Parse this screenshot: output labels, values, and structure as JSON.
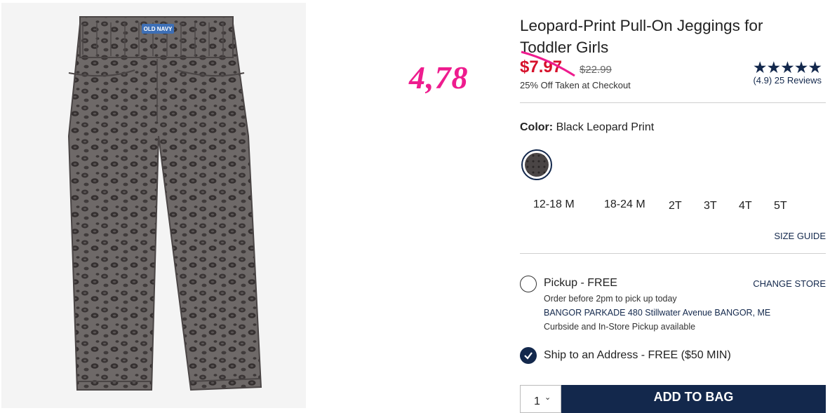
{
  "product": {
    "title": "Leopard-Print Pull-On Jeggings for Toddler Girls",
    "image_alt_icon": "jeggings-product-image",
    "waistband_logo": "OLD NAVY"
  },
  "annotation": {
    "handwritten_price": "4,78",
    "color": "#ee1c8e"
  },
  "pricing": {
    "sale_price": "$7.97",
    "original_price": "$22.99",
    "discount_note": "25% Off Taken at Checkout",
    "sale_color": "#d6112b"
  },
  "rating": {
    "stars": "★★★★★",
    "summary": "(4.9) 25 Reviews"
  },
  "color": {
    "label": "Color:",
    "value": "Black Leopard Print"
  },
  "sizes": [
    "12-18 M",
    "18-24 M",
    "2T",
    "3T",
    "4T",
    "5T"
  ],
  "size_guide": "SIZE GUIDE",
  "fulfillment": {
    "pickup_label": "Pickup - FREE",
    "pickup_note": "Order before 2pm to pick up today",
    "store": "BANGOR PARKADE 480 Stillwater Avenue  BANGOR, ME",
    "pickup_options": "Curbside and In-Store Pickup available",
    "change_store": "CHANGE STORE",
    "ship_label": "Ship to an Address - FREE ($50 MIN)"
  },
  "cart": {
    "quantity": "1",
    "add_button": "ADD TO BAG"
  },
  "theme": {
    "navy": "#13284c"
  }
}
